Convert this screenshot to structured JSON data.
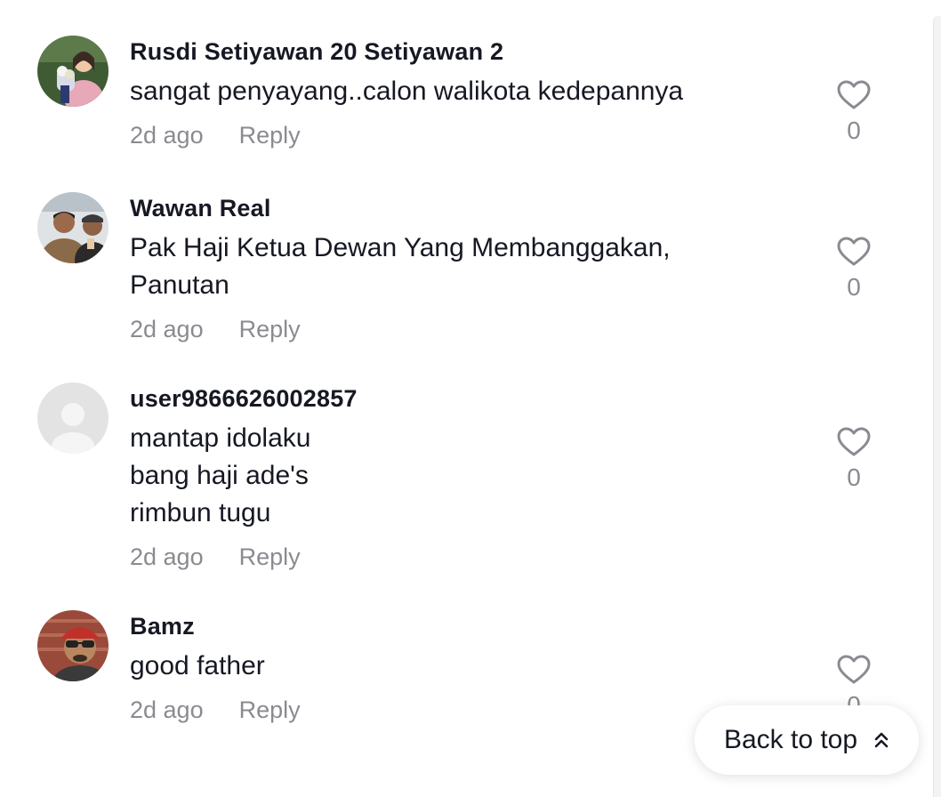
{
  "comments": [
    {
      "username": "Rusdi Setiyawan 20 Setiyawan 2",
      "lines": [
        "sangat penyayang..calon walikota kedepannya"
      ],
      "time": "2d ago",
      "reply_label": "Reply",
      "likes": "0",
      "avatar_icon": "photo-avatar-girl-with-bouquet"
    },
    {
      "username": "Wawan Real",
      "lines": [
        "Pak Haji Ketua Dewan Yang Membanggakan,",
        "Panutan"
      ],
      "time": "2d ago",
      "reply_label": "Reply",
      "likes": "0",
      "avatar_icon": "photo-avatar-two-men"
    },
    {
      "username": "user9866626002857",
      "lines": [
        "mantap idolaku",
        "bang haji ade's",
        "rimbun tugu"
      ],
      "time": "2d ago",
      "reply_label": "Reply",
      "likes": "0",
      "avatar_icon": "default-avatar-icon"
    },
    {
      "username": "Bamz",
      "lines": [
        "good father"
      ],
      "time": "2d ago",
      "reply_label": "Reply",
      "likes": "0",
      "avatar_icon": "photo-avatar-man-with-cap-sunglasses"
    }
  ],
  "back_to_top": {
    "label": "Back to top",
    "icon": "double-chevron-up-icon"
  },
  "colors": {
    "text_primary": "#161823",
    "text_secondary": "#8a8b91",
    "background": "#ffffff"
  }
}
